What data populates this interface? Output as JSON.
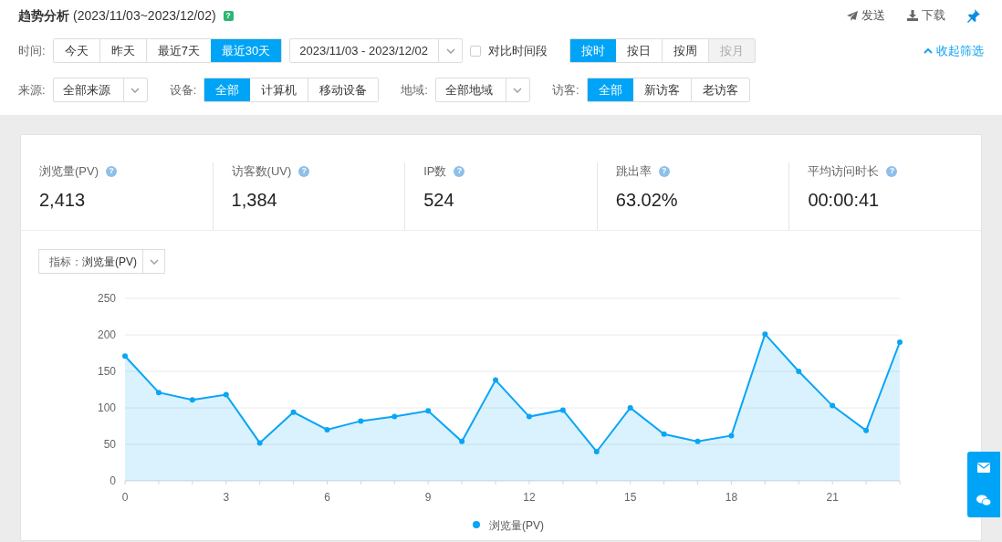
{
  "header": {
    "title": "趋势分析",
    "date_range": "(2023/11/03~2023/12/02)",
    "help": "?"
  },
  "actions": [
    {
      "kind": "send",
      "label": "发送"
    },
    {
      "kind": "download",
      "label": "下载"
    }
  ],
  "filters": {
    "time": {
      "label": "时间:",
      "options": [
        {
          "label": "今天",
          "selected": false
        },
        {
          "label": "昨天",
          "selected": false
        },
        {
          "label": "最近7天",
          "selected": false
        },
        {
          "label": "最近30天",
          "selected": true
        }
      ],
      "date_value": "2023/11/03 - 2023/12/02",
      "compare": {
        "label": "对比时间段",
        "checked": false
      }
    },
    "granularity": {
      "options": [
        {
          "label": "按时",
          "selected": true,
          "disabled": false
        },
        {
          "label": "按日",
          "selected": false,
          "disabled": false
        },
        {
          "label": "按周",
          "selected": false,
          "disabled": false
        },
        {
          "label": "按月",
          "selected": false,
          "disabled": true
        }
      ]
    },
    "collapse": "收起筛选",
    "source": {
      "label": "来源:",
      "value": "全部来源"
    },
    "device": {
      "label": "设备:",
      "options": [
        {
          "label": "全部",
          "selected": true
        },
        {
          "label": "计算机",
          "selected": false
        },
        {
          "label": "移动设备",
          "selected": false
        }
      ]
    },
    "region": {
      "label": "地域:",
      "value": "全部地域"
    },
    "visitor": {
      "label": "访客:",
      "options": [
        {
          "label": "全部",
          "selected": true
        },
        {
          "label": "新访客",
          "selected": false
        },
        {
          "label": "老访客",
          "selected": false
        }
      ]
    }
  },
  "metrics": [
    {
      "label": "浏览量(PV)",
      "help": "?",
      "value": "2,413"
    },
    {
      "label": "访客数(UV)",
      "help": "?",
      "value": "1,384"
    },
    {
      "label": "IP数",
      "help": "?",
      "value": "524"
    },
    {
      "label": "跳出率",
      "help": "?",
      "value": "63.02%"
    },
    {
      "label": "平均访问时长",
      "help": "?",
      "value": "00:00:41"
    }
  ],
  "chart": {
    "metric_label": "指标：",
    "metric_value": "浏览量(PV)",
    "chart_data": {
      "type": "area",
      "x": [
        0,
        1,
        2,
        3,
        4,
        5,
        6,
        7,
        8,
        9,
        10,
        11,
        12,
        13,
        14,
        15,
        16,
        17,
        18,
        19,
        20,
        21,
        22,
        23
      ],
      "series": [
        {
          "name": "浏览量(PV)",
          "color": "#0aa5f5",
          "values": [
            171,
            121,
            111,
            118,
            52,
            94,
            70,
            82,
            88,
            96,
            54,
            138,
            88,
            97,
            40,
            100,
            64,
            54,
            62,
            201,
            150,
            103,
            69,
            190
          ]
        }
      ],
      "xlim": [
        0,
        23
      ],
      "ylim": [
        0,
        250
      ],
      "grid": true,
      "yticks": [
        0,
        50,
        100,
        150,
        200,
        250
      ],
      "xticks": [
        0,
        3,
        6,
        9,
        12,
        15,
        18,
        21
      ]
    }
  }
}
